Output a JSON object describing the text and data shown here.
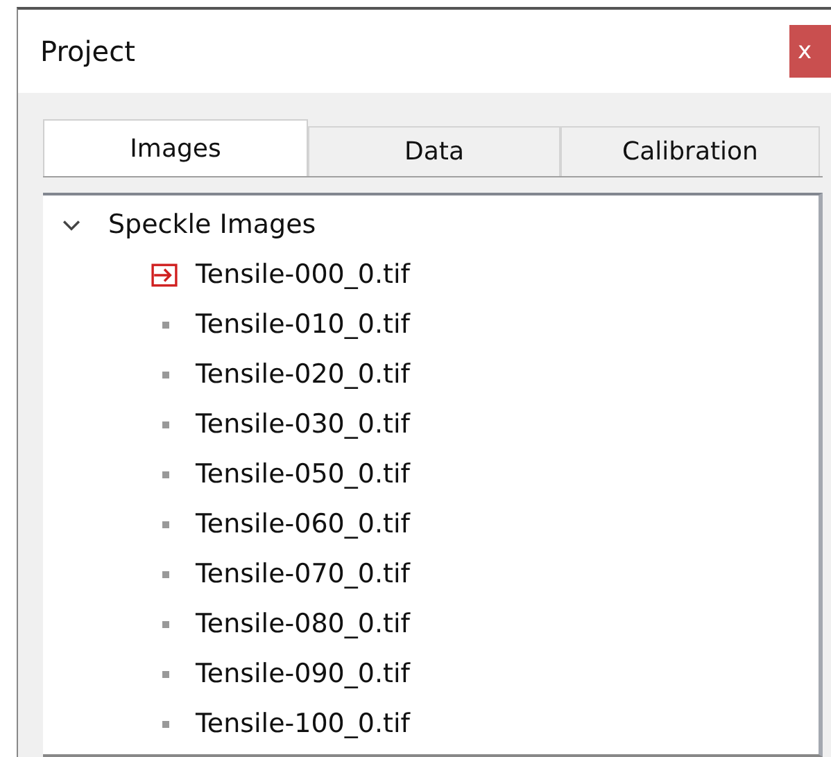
{
  "window": {
    "title": "Project",
    "close": "x"
  },
  "tabs": [
    {
      "label": "Images",
      "selected": true
    },
    {
      "label": "Data",
      "selected": false
    },
    {
      "label": "Calibration",
      "selected": false
    }
  ],
  "tree": {
    "label": "Speckle Images",
    "expanded": true,
    "children": [
      {
        "label": "Tensile-000_0.tif",
        "current": true
      },
      {
        "label": "Tensile-010_0.tif",
        "current": false
      },
      {
        "label": "Tensile-020_0.tif",
        "current": false
      },
      {
        "label": "Tensile-030_0.tif",
        "current": false
      },
      {
        "label": "Tensile-050_0.tif",
        "current": false
      },
      {
        "label": "Tensile-060_0.tif",
        "current": false
      },
      {
        "label": "Tensile-070_0.tif",
        "current": false
      },
      {
        "label": "Tensile-080_0.tif",
        "current": false
      },
      {
        "label": "Tensile-090_0.tif",
        "current": false
      },
      {
        "label": "Tensile-100_0.tif",
        "current": false
      }
    ]
  }
}
